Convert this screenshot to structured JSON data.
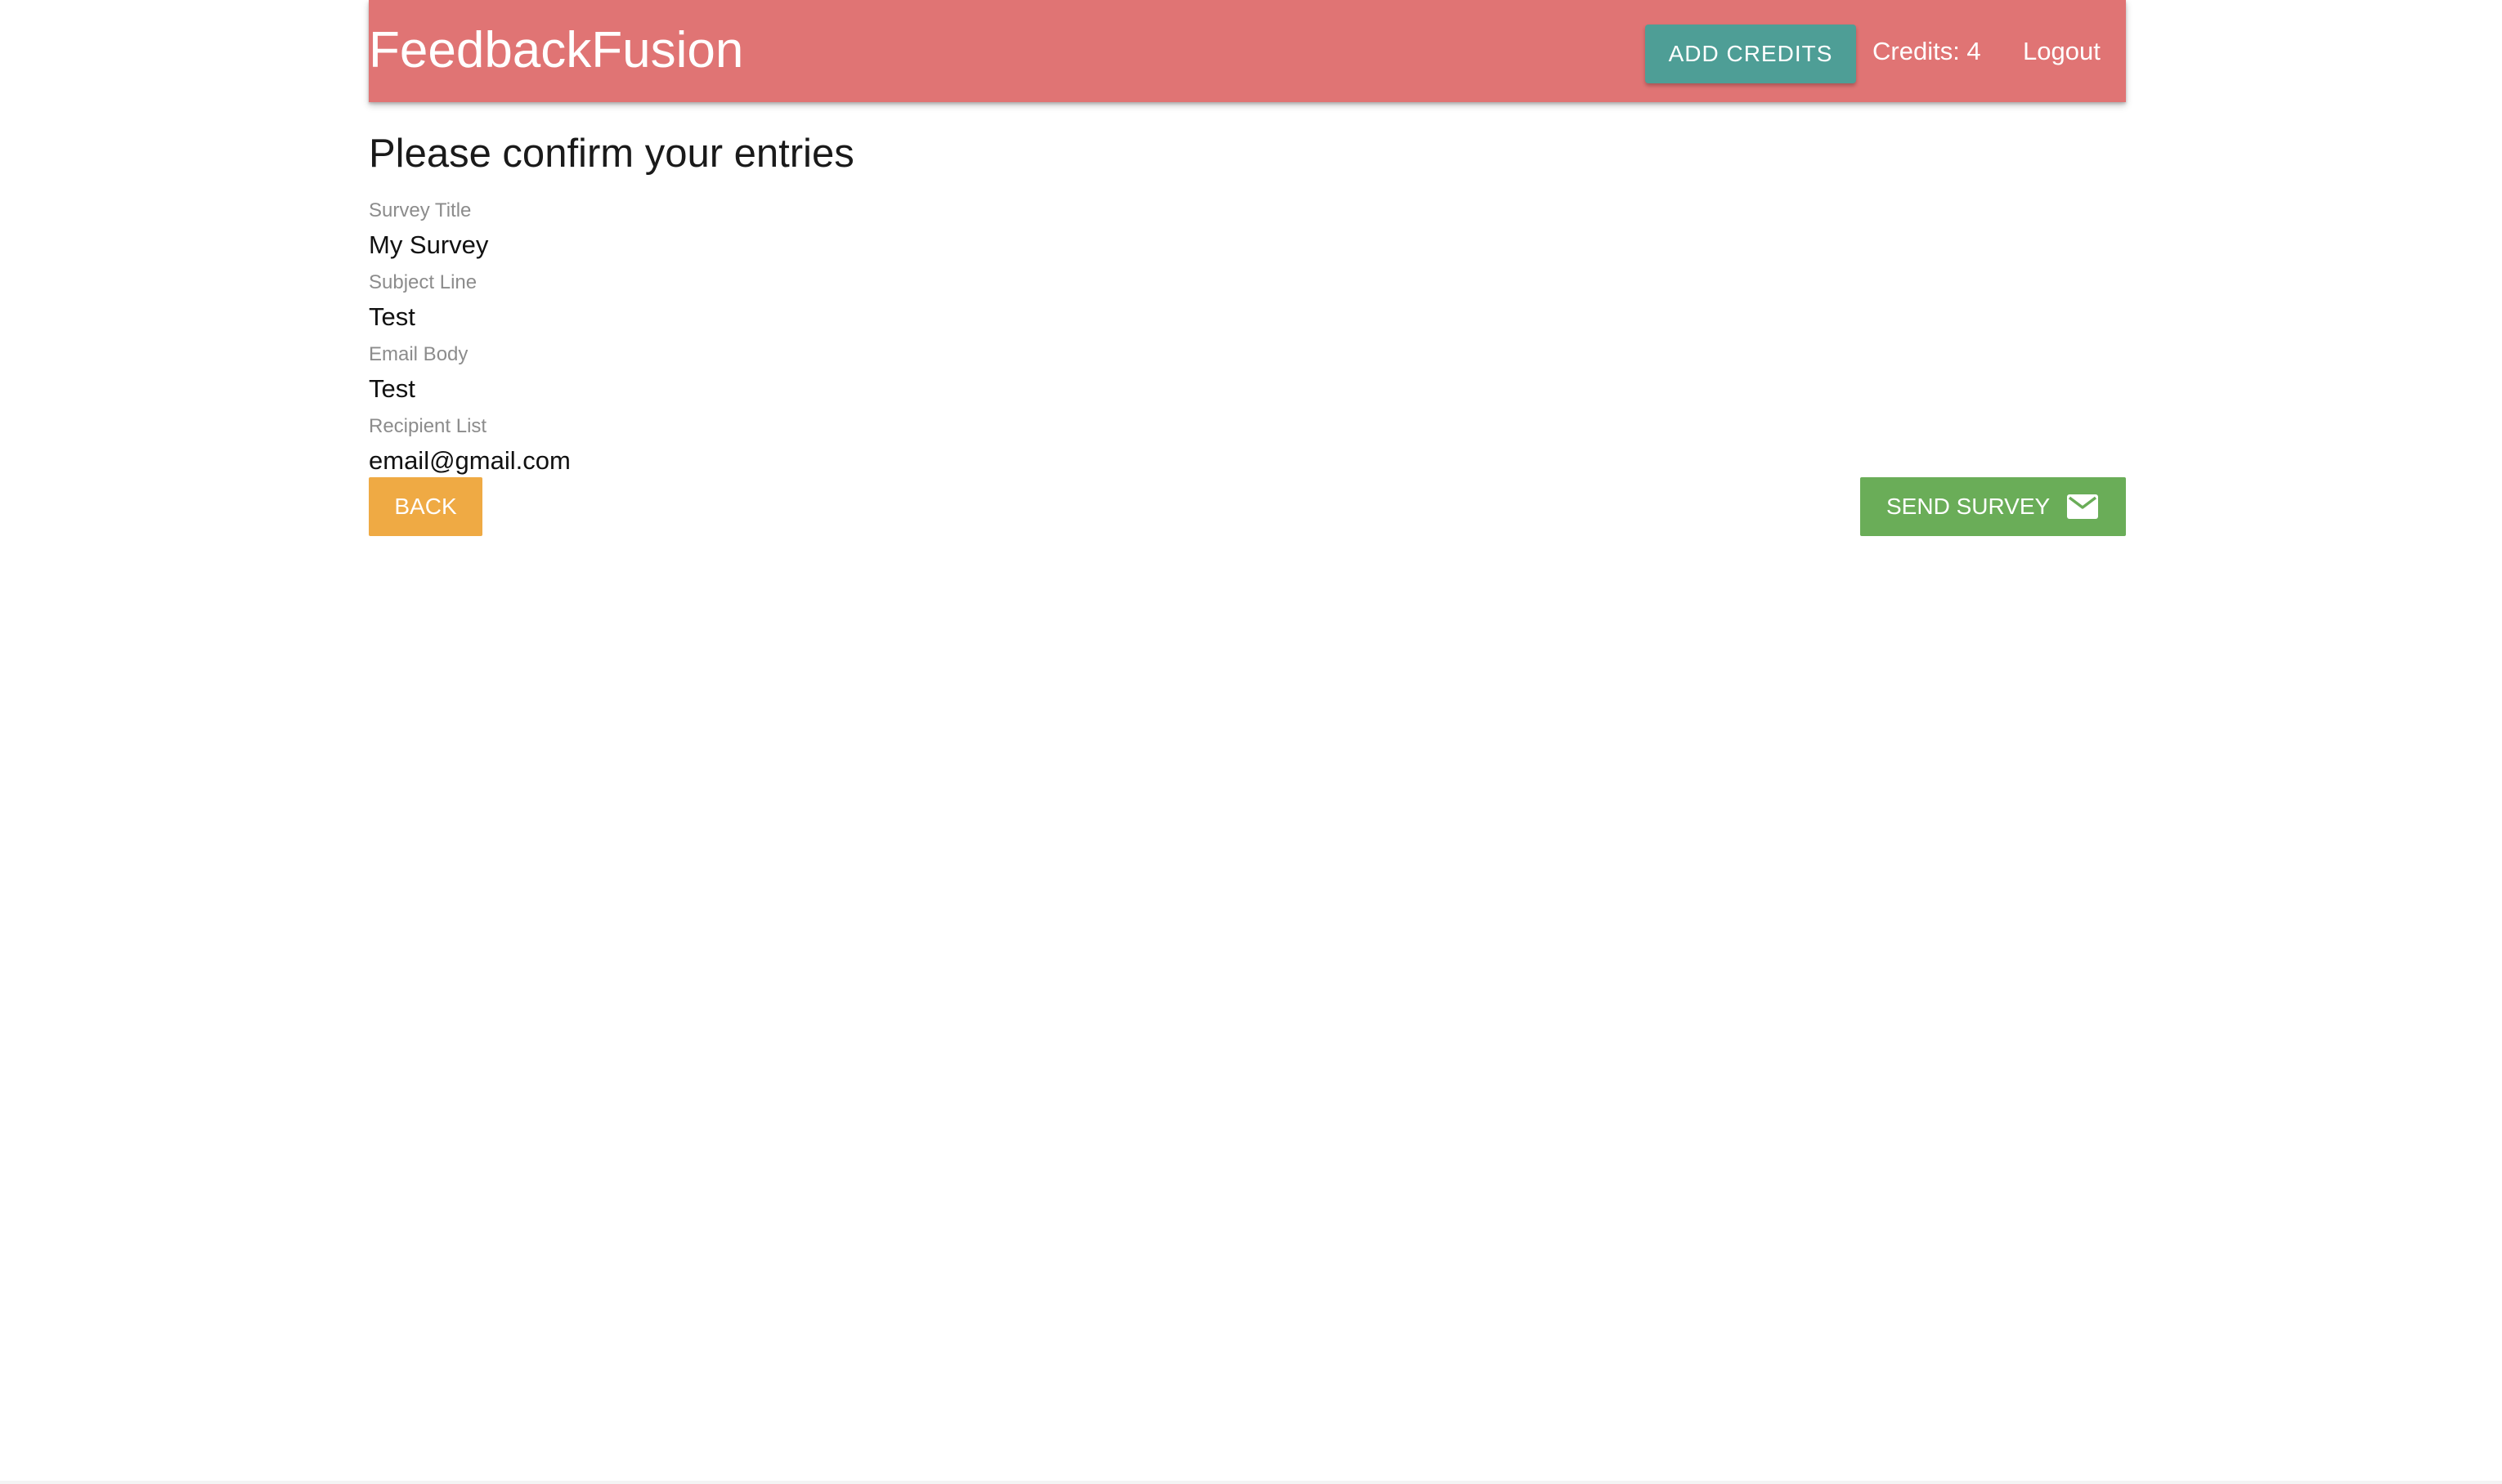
{
  "header": {
    "brand": "FeedbackFusion",
    "add_credits_label": "Add Credits",
    "credits_text": "Credits: 4",
    "logout_label": "Logout"
  },
  "main": {
    "title": "Please confirm your entries",
    "fields": [
      {
        "label": "Survey Title",
        "value": "My Survey"
      },
      {
        "label": "Subject Line",
        "value": "Test"
      },
      {
        "label": "Email Body",
        "value": "Test"
      },
      {
        "label": "Recipient List",
        "value": "email@gmail.com"
      }
    ],
    "back_label": "Back",
    "send_label": "Send Survey",
    "send_icon": "mail-icon"
  },
  "colors": {
    "header_bg": "#e07474",
    "add_credits_bg": "#4e9e96",
    "back_bg": "#efaa44",
    "send_bg": "#6aad58"
  }
}
